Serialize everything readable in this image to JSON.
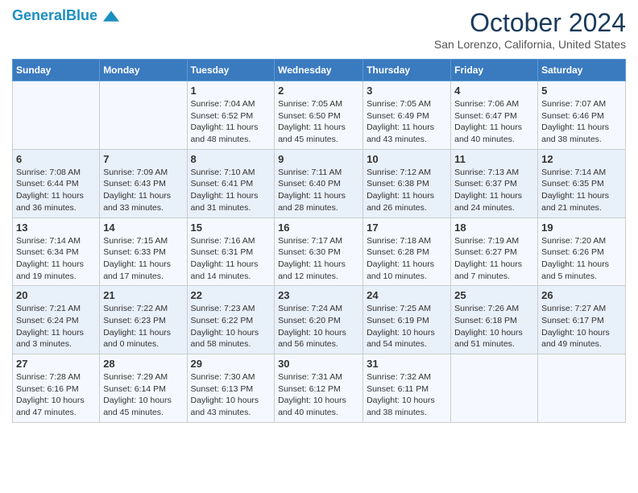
{
  "header": {
    "logo_line1": "General",
    "logo_line2": "Blue",
    "month_title": "October 2024",
    "location": "San Lorenzo, California, United States"
  },
  "weekdays": [
    "Sunday",
    "Monday",
    "Tuesday",
    "Wednesday",
    "Thursday",
    "Friday",
    "Saturday"
  ],
  "weeks": [
    [
      {
        "day": "",
        "info": ""
      },
      {
        "day": "",
        "info": ""
      },
      {
        "day": "1",
        "info": "Sunrise: 7:04 AM\nSunset: 6:52 PM\nDaylight: 11 hours and 48 minutes."
      },
      {
        "day": "2",
        "info": "Sunrise: 7:05 AM\nSunset: 6:50 PM\nDaylight: 11 hours and 45 minutes."
      },
      {
        "day": "3",
        "info": "Sunrise: 7:05 AM\nSunset: 6:49 PM\nDaylight: 11 hours and 43 minutes."
      },
      {
        "day": "4",
        "info": "Sunrise: 7:06 AM\nSunset: 6:47 PM\nDaylight: 11 hours and 40 minutes."
      },
      {
        "day": "5",
        "info": "Sunrise: 7:07 AM\nSunset: 6:46 PM\nDaylight: 11 hours and 38 minutes."
      }
    ],
    [
      {
        "day": "6",
        "info": "Sunrise: 7:08 AM\nSunset: 6:44 PM\nDaylight: 11 hours and 36 minutes."
      },
      {
        "day": "7",
        "info": "Sunrise: 7:09 AM\nSunset: 6:43 PM\nDaylight: 11 hours and 33 minutes."
      },
      {
        "day": "8",
        "info": "Sunrise: 7:10 AM\nSunset: 6:41 PM\nDaylight: 11 hours and 31 minutes."
      },
      {
        "day": "9",
        "info": "Sunrise: 7:11 AM\nSunset: 6:40 PM\nDaylight: 11 hours and 28 minutes."
      },
      {
        "day": "10",
        "info": "Sunrise: 7:12 AM\nSunset: 6:38 PM\nDaylight: 11 hours and 26 minutes."
      },
      {
        "day": "11",
        "info": "Sunrise: 7:13 AM\nSunset: 6:37 PM\nDaylight: 11 hours and 24 minutes."
      },
      {
        "day": "12",
        "info": "Sunrise: 7:14 AM\nSunset: 6:35 PM\nDaylight: 11 hours and 21 minutes."
      }
    ],
    [
      {
        "day": "13",
        "info": "Sunrise: 7:14 AM\nSunset: 6:34 PM\nDaylight: 11 hours and 19 minutes."
      },
      {
        "day": "14",
        "info": "Sunrise: 7:15 AM\nSunset: 6:33 PM\nDaylight: 11 hours and 17 minutes."
      },
      {
        "day": "15",
        "info": "Sunrise: 7:16 AM\nSunset: 6:31 PM\nDaylight: 11 hours and 14 minutes."
      },
      {
        "day": "16",
        "info": "Sunrise: 7:17 AM\nSunset: 6:30 PM\nDaylight: 11 hours and 12 minutes."
      },
      {
        "day": "17",
        "info": "Sunrise: 7:18 AM\nSunset: 6:28 PM\nDaylight: 11 hours and 10 minutes."
      },
      {
        "day": "18",
        "info": "Sunrise: 7:19 AM\nSunset: 6:27 PM\nDaylight: 11 hours and 7 minutes."
      },
      {
        "day": "19",
        "info": "Sunrise: 7:20 AM\nSunset: 6:26 PM\nDaylight: 11 hours and 5 minutes."
      }
    ],
    [
      {
        "day": "20",
        "info": "Sunrise: 7:21 AM\nSunset: 6:24 PM\nDaylight: 11 hours and 3 minutes."
      },
      {
        "day": "21",
        "info": "Sunrise: 7:22 AM\nSunset: 6:23 PM\nDaylight: 11 hours and 0 minutes."
      },
      {
        "day": "22",
        "info": "Sunrise: 7:23 AM\nSunset: 6:22 PM\nDaylight: 10 hours and 58 minutes."
      },
      {
        "day": "23",
        "info": "Sunrise: 7:24 AM\nSunset: 6:20 PM\nDaylight: 10 hours and 56 minutes."
      },
      {
        "day": "24",
        "info": "Sunrise: 7:25 AM\nSunset: 6:19 PM\nDaylight: 10 hours and 54 minutes."
      },
      {
        "day": "25",
        "info": "Sunrise: 7:26 AM\nSunset: 6:18 PM\nDaylight: 10 hours and 51 minutes."
      },
      {
        "day": "26",
        "info": "Sunrise: 7:27 AM\nSunset: 6:17 PM\nDaylight: 10 hours and 49 minutes."
      }
    ],
    [
      {
        "day": "27",
        "info": "Sunrise: 7:28 AM\nSunset: 6:16 PM\nDaylight: 10 hours and 47 minutes."
      },
      {
        "day": "28",
        "info": "Sunrise: 7:29 AM\nSunset: 6:14 PM\nDaylight: 10 hours and 45 minutes."
      },
      {
        "day": "29",
        "info": "Sunrise: 7:30 AM\nSunset: 6:13 PM\nDaylight: 10 hours and 43 minutes."
      },
      {
        "day": "30",
        "info": "Sunrise: 7:31 AM\nSunset: 6:12 PM\nDaylight: 10 hours and 40 minutes."
      },
      {
        "day": "31",
        "info": "Sunrise: 7:32 AM\nSunset: 6:11 PM\nDaylight: 10 hours and 38 minutes."
      },
      {
        "day": "",
        "info": ""
      },
      {
        "day": "",
        "info": ""
      }
    ]
  ]
}
